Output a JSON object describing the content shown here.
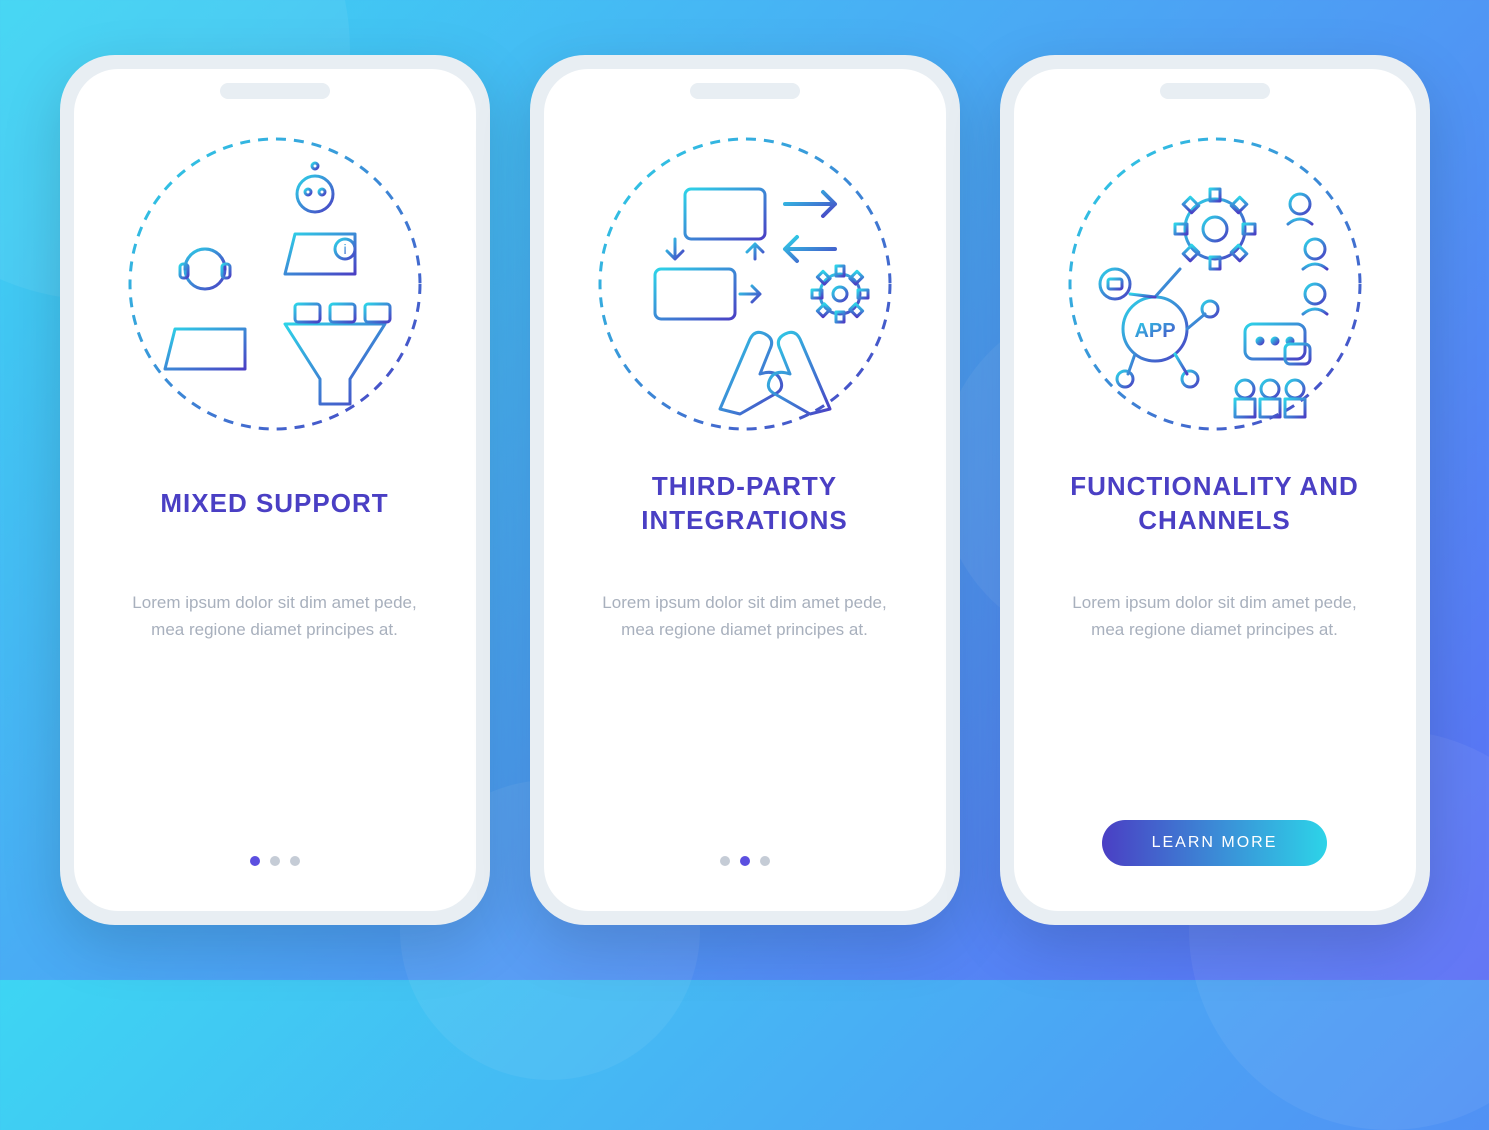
{
  "screens": [
    {
      "title": "MIXED SUPPORT",
      "description": "Lorem ipsum dolor sit dim amet pede, mea regione diamet principes at.",
      "icon": "mixed-support-icon",
      "has_button": false,
      "active_dot": 0
    },
    {
      "title": "THIRD-PARTY INTEGRATIONS",
      "description": "Lorem ipsum dolor sit dim amet pede, mea regione diamet principes at.",
      "icon": "integrations-icon",
      "has_button": false,
      "active_dot": 1
    },
    {
      "title": "FUNCTIONALITY AND CHANNELS",
      "description": "Lorem ipsum dolor sit dim amet pede, mea regione diamet principes at.",
      "icon": "functionality-icon",
      "has_button": true,
      "active_dot": 2
    }
  ],
  "cta_label": "LEARN MORE",
  "colors": {
    "title": "#4a3fc4",
    "gradient_start": "#3dd5f3",
    "gradient_end": "#5b6ef5",
    "button_gradient_start": "#4a3fc4",
    "button_gradient_end": "#2dd4e8"
  },
  "app_label": "APP"
}
